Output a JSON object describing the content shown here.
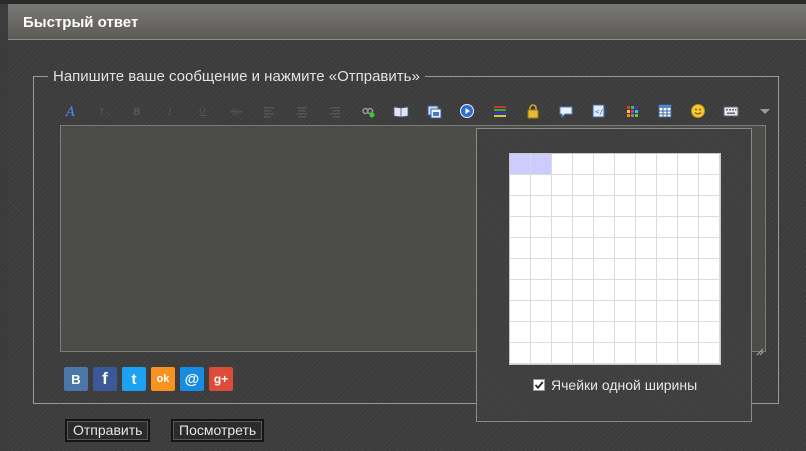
{
  "panel": {
    "title": "Быстрый ответ"
  },
  "form": {
    "legend": "Напишите ваше сообщение и нажмите «Отправить»",
    "message_value": "",
    "submit_label": "Отправить",
    "preview_label": "Посмотреть"
  },
  "toolbar": {
    "items": [
      "font-icon",
      "font-size-icon",
      "bold-icon",
      "italic-icon",
      "underline-icon",
      "strikethrough-icon",
      "align-left-icon",
      "align-center-icon",
      "align-right-icon",
      "link-icon",
      "book-icon",
      "image-icon",
      "media-icon",
      "list-icon",
      "lock-icon",
      "speech-bubble-icon",
      "code-icon",
      "color-palette-icon",
      "table-icon",
      "smiley-icon",
      "keyboard-icon",
      "more-dropdown-icon"
    ]
  },
  "social": {
    "items": [
      {
        "name": "vkontakte-icon",
        "letter": "B",
        "color": "#4a76a8"
      },
      {
        "name": "facebook-icon",
        "letter": "f",
        "color": "#3b5998"
      },
      {
        "name": "twitter-icon",
        "letter": "t",
        "color": "#1da1f2"
      },
      {
        "name": "odnoklassniki-icon",
        "letter": "ok",
        "color": "#f7931e"
      },
      {
        "name": "mailru-icon",
        "letter": "@",
        "color": "#168de2"
      },
      {
        "name": "googleplus-icon",
        "letter": "g+",
        "color": "#dd4b39"
      }
    ]
  },
  "table_popup": {
    "rows": 10,
    "cols": 10,
    "selected_rows": 1,
    "selected_cols": 2,
    "equal_width_label": "Ячейки одной ширины",
    "equal_width_checked": true
  },
  "colors": {
    "header": "#6b6965",
    "editor_bg": "#4c4c48",
    "cell_selected": "#ccccff"
  }
}
